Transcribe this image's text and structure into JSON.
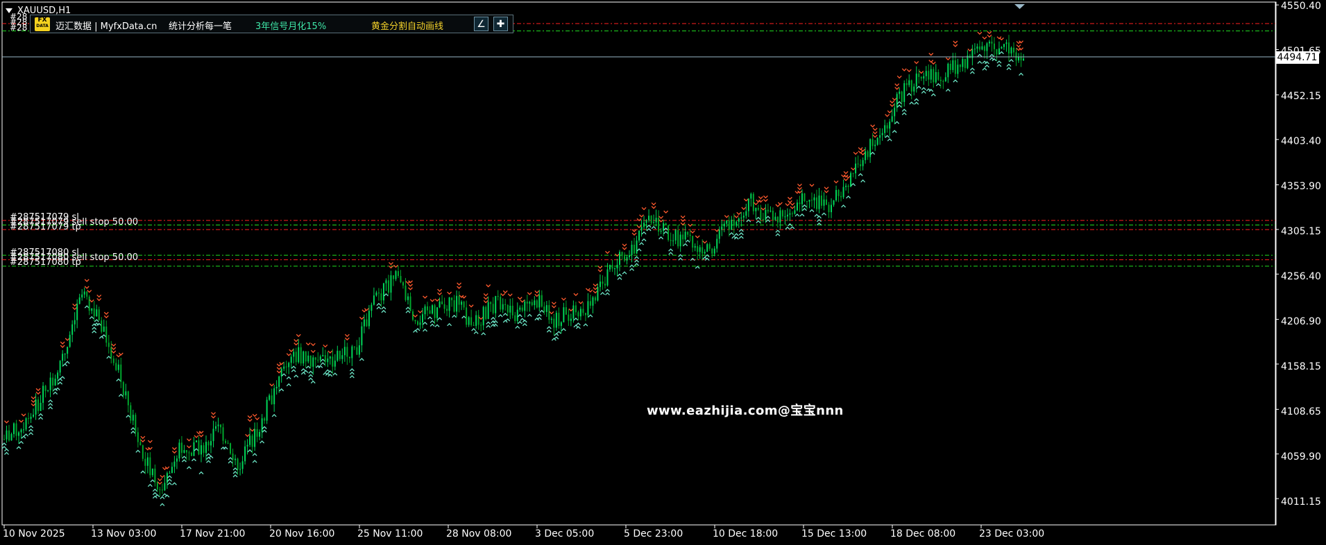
{
  "symbol": "XAUUSD,H1",
  "toolbar": {
    "logo_top": "FX",
    "logo_bottom": "DATA",
    "brand": "迈汇数据 | MyfxData.cn",
    "stats": "统计分析每一笔",
    "signal": "3年信号月化15%",
    "gold": "黄金分割自动画线",
    "accent_green": "#3fe6a8",
    "accent_gold": "#f2d02a"
  },
  "price_axis": {
    "labels": [
      "4550.40",
      "4501.65",
      "4452.15",
      "4403.40",
      "4353.90",
      "4305.15",
      "4256.40",
      "4206.90",
      "4158.15",
      "4108.65",
      "4059.90",
      "4011.15"
    ],
    "current_price": "4494.71",
    "ylim": [
      3990,
      4552
    ]
  },
  "time_axis": {
    "labels": [
      "10 Nov 2025",
      "13 Nov 03:00",
      "17 Nov 21:00",
      "20 Nov 16:00",
      "25 Nov 11:00",
      "28 Nov 08:00",
      "3 Dec 05:00",
      "5 Dec 23:00",
      "10 Dec 18:00",
      "15 Dec 13:00",
      "18 Dec 08:00",
      "23 Dec 03:00"
    ]
  },
  "orders": [
    {
      "line1": "#287517079 sl",
      "line2": "#287517079 sell stop 50.00",
      "line3": "#287517079 tp"
    },
    {
      "line1": "#287517080 sl",
      "line2": "#287517080 sell stop 50.00",
      "line3": "#287517080 tp"
    }
  ],
  "top_order_tags": [
    "#28",
    "#28",
    "#28"
  ],
  "watermark": "www.eazhijia.com@宝宝nnn",
  "colors": {
    "background": "#000000",
    "axis": "#ffffff",
    "bull": "#00d85a",
    "bear": "#00a82d",
    "arrow_up": "#6de8c8",
    "arrow_down": "#ff5a2e",
    "order_red": "#ff2020",
    "order_green": "#20e020",
    "current_line": "#9ab8c8"
  },
  "chart_data": {
    "type": "candlestick",
    "x": [
      "10 Nov 2025",
      "13 Nov 03:00",
      "17 Nov 21:00",
      "20 Nov 16:00",
      "25 Nov 11:00",
      "28 Nov 08:00",
      "3 Dec 05:00",
      "5 Dec 23:00",
      "10 Dec 18:00",
      "15 Dec 13:00",
      "18 Dec 08:00",
      "23 Dec 03:00"
    ],
    "close_path": [
      4076,
      4092,
      4125,
      4165,
      4235,
      4200,
      4138,
      4066,
      4020,
      4068,
      4064,
      4089,
      4048,
      4090,
      4140,
      4170,
      4158,
      4165,
      4178,
      4232,
      4255,
      4208,
      4216,
      4225,
      4200,
      4225,
      4214,
      4232,
      4205,
      4215,
      4223,
      4265,
      4282,
      4318,
      4298,
      4292,
      4284,
      4314,
      4336,
      4320,
      4318,
      4346,
      4325,
      4355,
      4392,
      4422,
      4462,
      4470,
      4475,
      4490,
      4500,
      4505,
      4494.71
    ],
    "series_lines": [
      "4530",
      "4522",
      "4315",
      "4310",
      "4305",
      "4277",
      "4272",
      "4265"
    ],
    "ylim": [
      3990,
      4552
    ]
  }
}
